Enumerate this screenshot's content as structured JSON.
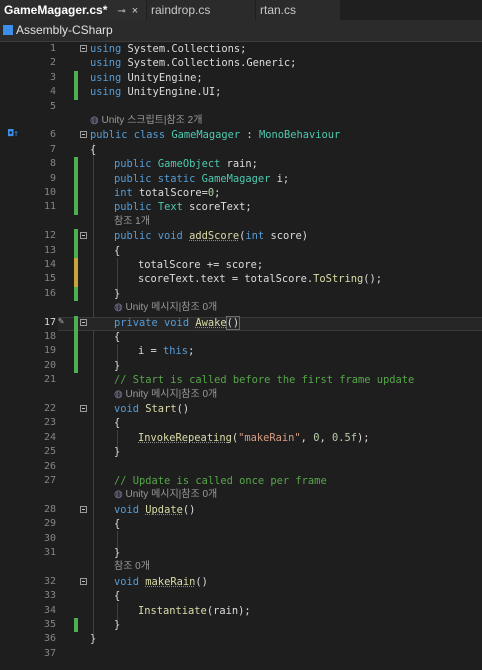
{
  "tabs": [
    {
      "label": "GameMagager.cs*",
      "pin": "⊸",
      "close": "×"
    },
    {
      "label": "raindrop.cs"
    },
    {
      "label": "rtan.cs"
    }
  ],
  "navbar": {
    "project": "Assembly-CSharp"
  },
  "lens": {
    "script": "Unity 스크립트|참조 2개",
    "ref1": "참조 1개",
    "msg0": "Unity 메시지|참조 0개",
    "ref0": "참조 0개"
  },
  "line_numbers": [
    "1",
    "2",
    "3",
    "4",
    "5",
    "6",
    "7",
    "8",
    "9",
    "10",
    "11",
    "12",
    "13",
    "14",
    "15",
    "16",
    "17",
    "18",
    "19",
    "20",
    "21",
    "22",
    "23",
    "24",
    "25",
    "26",
    "27",
    "28",
    "29",
    "30",
    "31",
    "32",
    "33",
    "34",
    "35",
    "36",
    "37"
  ],
  "code": {
    "l1a": "using",
    "l1b": " System.Collections;",
    "l2a": "using",
    "l2b": " System.Collections.Generic;",
    "l3a": "using",
    "l3b": " UnityEngine;",
    "l4a": "using",
    "l4b": " UnityEngine.UI;",
    "l6a": "public class",
    "l6b": "GameMagager",
    "l6c": " : ",
    "l6d": "MonoBehaviour",
    "l7": "{",
    "l8a": "public",
    "l8b": "GameObject",
    "l8c": " rain;",
    "l9a": "public static",
    "l9b": "GameMagager",
    "l9c": " i;",
    "l10a": "int",
    "l10b": " totalScore=",
    "l10c": "0",
    "l10d": ";",
    "l11a": "public",
    "l11b": "Text",
    "l11c": " scoreText;",
    "l12a": "public void",
    "l12b": "addScore",
    "l12c": "(",
    "l12d": "int",
    "l12e": " score)",
    "l13": "{",
    "l14a": "totalScore += score;",
    "l15a": "scoreText.text = totalScore.",
    "l15b": "ToString",
    "l15c": "();",
    "l16": "}",
    "l17a": "private void",
    "l17b": "Awake",
    "l17c": "()",
    "l18": "{",
    "l19a": "i = ",
    "l19b": "this",
    "l19c": ";",
    "l20": "}",
    "l21": "// Start is called before the first frame update",
    "l22a": "void",
    "l22b": "Start",
    "l22c": "()",
    "l23": "{",
    "l24a": "InvokeRepeating",
    "l24b": "(",
    "l24c": "\"makeRain\"",
    "l24d": ", ",
    "l24e": "0",
    "l24f": ", ",
    "l24g": "0.5f",
    "l24h": ");",
    "l25": "}",
    "l27": "// Update is called once per frame",
    "l28a": "void",
    "l28b": "Update",
    "l28c": "()",
    "l29": "{",
    "l31": "}",
    "l32a": "void",
    "l32b": "makeRain",
    "l32c": "()",
    "l33": "{",
    "l34a": "Instantiate",
    "l34b": "(rain);",
    "l35": "}",
    "l36": "}"
  },
  "colors": {
    "keyword": "#569cd6",
    "type": "#4ec9b0",
    "method": "#dcdcaa",
    "string": "#d69d85",
    "number": "#b5cea8",
    "comment": "#57a64a",
    "changed_saved": "#4caf50",
    "changed_unsaved": "#c9a33a"
  }
}
